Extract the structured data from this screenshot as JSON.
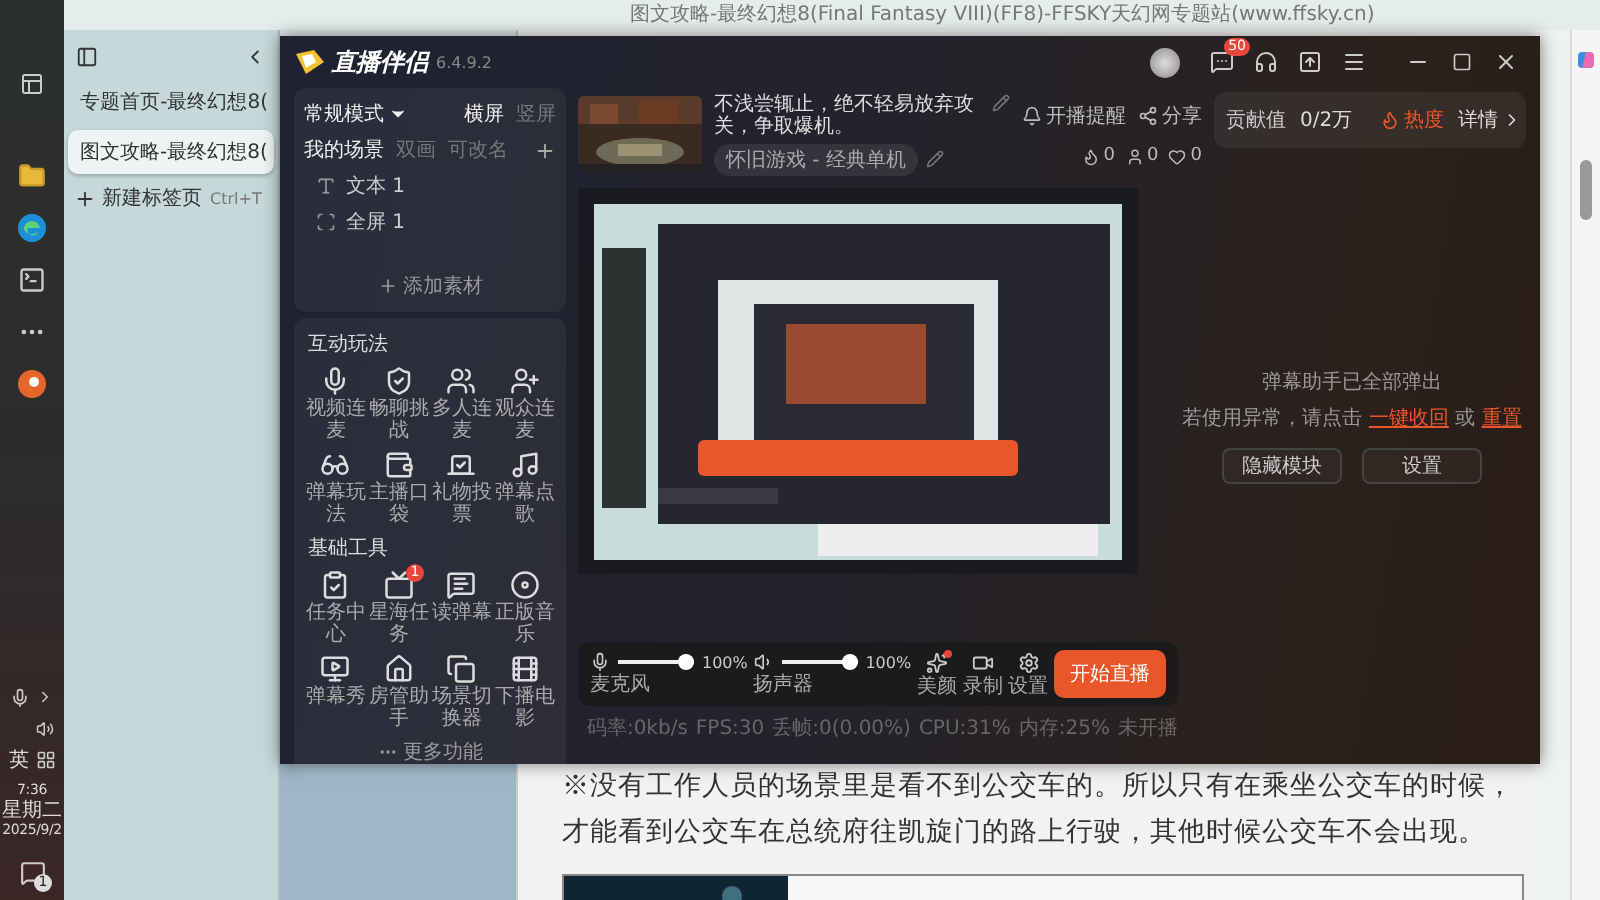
{
  "taskbar": {
    "ime": "英",
    "time": "7:36",
    "weekday": "星期二",
    "date": "2025/9/2",
    "notification_badge": "1"
  },
  "browser": {
    "title": "图文攻略-最终幻想8(Final Fantasy VIII)(FF8)-FFSKY天幻网专题站(www.ffsky.cn)",
    "tabs": [
      {
        "label": "专题首页-最终幻想8(",
        "selected": false
      },
      {
        "label": "图文攻略-最终幻想8(",
        "selected": true
      }
    ],
    "new_tab": {
      "label": "新建标签页",
      "shortcut": "Ctrl+T"
    },
    "article": {
      "paragraph": "※没有工作人员的场景里是看不到公交车的。所以只有在乘坐公交车的时候，才能看到公交车在总统府往凯旋门的路上行驶，其他时候公交车不会出现。"
    }
  },
  "app": {
    "name": "直播伴侣",
    "version": "6.4.9.2",
    "message_badge": "50",
    "mode": "常规模式",
    "orientations": [
      {
        "label": "横屏",
        "selected": true
      },
      {
        "label": "竖屏",
        "selected": false
      }
    ],
    "scene_tabs": [
      {
        "label": "我的场景",
        "selected": true
      },
      {
        "label": "双画",
        "selected": false
      },
      {
        "label": "可改名",
        "selected": false
      }
    ],
    "scenes": [
      {
        "kind": "text",
        "label": "文本 1"
      },
      {
        "kind": "screen",
        "label": "全屏 1"
      }
    ],
    "add_material": "添加素材",
    "sections": [
      {
        "title": "互动玩法",
        "tools": [
          {
            "label": "视频连麦"
          },
          {
            "label": "畅聊挑战"
          },
          {
            "label": "多人连麦"
          },
          {
            "label": "观众连麦"
          },
          {
            "label": "弹幕玩法"
          },
          {
            "label": "主播口袋"
          },
          {
            "label": "礼物投票"
          },
          {
            "label": "弹幕点歌"
          }
        ]
      },
      {
        "title": "基础工具",
        "tools": [
          {
            "label": "任务中心"
          },
          {
            "label": "星海任务",
            "badge": "1"
          },
          {
            "label": "读弹幕"
          },
          {
            "label": "正版音乐"
          },
          {
            "label": "弹幕秀"
          },
          {
            "label": "房管助手"
          },
          {
            "label": "场景切换器"
          },
          {
            "label": "下播电影"
          }
        ]
      }
    ],
    "more": "更多功能",
    "stream_title": "不浅尝辄止，绝不轻易放弃攻关，争取爆机。",
    "category": "怀旧游戏 - 经典单机",
    "reminder": "开播提醒",
    "share": "分享",
    "stats": [
      "0",
      "0",
      "0"
    ],
    "contribution": {
      "label": "贡献值",
      "value": "0/2万",
      "heat": "热度",
      "details": "详情"
    },
    "notice": {
      "line1": "弹幕助手已全部弹出",
      "line2": [
        {
          "kind": "text",
          "text": "若使用异常，请点击 "
        },
        {
          "kind": "link",
          "text": "一键收回"
        },
        {
          "kind": "text",
          "text": " 或 "
        },
        {
          "kind": "link",
          "text": "重置"
        }
      ],
      "buttons": [
        "隐藏模块",
        "设置"
      ]
    },
    "audio": [
      {
        "label": "麦克风",
        "level": 1,
        "reading": "100%"
      },
      {
        "label": "扬声器",
        "level": 1,
        "reading": "100%"
      }
    ],
    "actions": [
      {
        "label": "美颜",
        "dot": true
      },
      {
        "label": "录制",
        "dot": false
      },
      {
        "label": "设置",
        "dot": false
      }
    ],
    "start": "开始直播",
    "status": [
      "码率:0kb/s",
      "FPS:30",
      "丢帧:0(0.00%)",
      "CPU:31%",
      "内存:25%",
      "未开播"
    ]
  }
}
